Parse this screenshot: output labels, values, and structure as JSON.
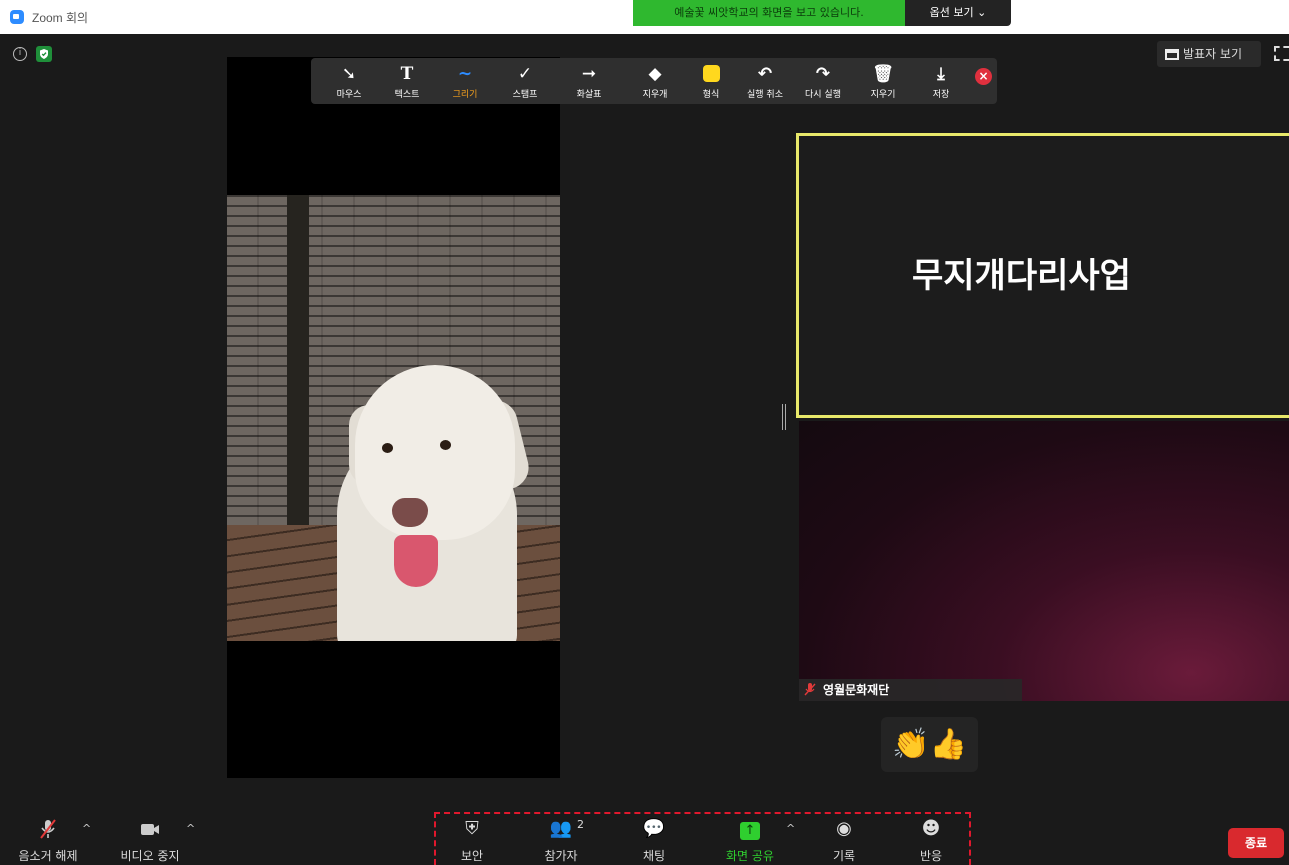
{
  "window": {
    "title": "Zoom 회의"
  },
  "share_banner": {
    "text": "예술꽃 씨앗학교의 화면을 보고 있습니다.",
    "options_label": "옵션 보기 ⌄"
  },
  "topbar": {
    "speaker_view_label": "발표자 보기"
  },
  "annotation_toolbar": {
    "tools": [
      {
        "id": "mouse",
        "icon": "arrow-cursor-icon",
        "label": "마우스"
      },
      {
        "id": "text",
        "icon": "text-t-icon",
        "label": "텍스트"
      },
      {
        "id": "draw",
        "icon": "squiggle-line-icon",
        "label": "그리기",
        "active": true
      },
      {
        "id": "stamp",
        "icon": "checkmark-icon",
        "label": "스탬프"
      },
      {
        "id": "arrow",
        "icon": "right-arrow-icon",
        "label": "화살표"
      },
      {
        "id": "eraser",
        "icon": "eraser-icon",
        "label": "지우개"
      },
      {
        "id": "format",
        "icon": "color-swatch-icon",
        "label": "형식",
        "color": "#ffd81e"
      },
      {
        "id": "undo",
        "icon": "undo-icon",
        "label": "실행 취소"
      },
      {
        "id": "redo",
        "icon": "redo-icon",
        "label": "다시 실행"
      },
      {
        "id": "clear",
        "icon": "trash-icon",
        "label": "지우기"
      },
      {
        "id": "save",
        "icon": "save-download-icon",
        "label": "저장"
      }
    ]
  },
  "participants": {
    "active_speaker_name": "무지개다리사업",
    "video_tile_name": "영월문화재단"
  },
  "reactions": {
    "emojis": "👏👍"
  },
  "bottom_toolbar": {
    "mute_label": "음소거 해제",
    "video_label": "비디오 중지",
    "security_label": "보안",
    "participants_label": "참가자",
    "participants_count": "2",
    "chat_label": "채팅",
    "share_label": "화면 공유",
    "record_label": "기록",
    "reactions_label": "반응",
    "end_label": "종료"
  },
  "colors": {
    "share_green": "#2fb82f",
    "end_red": "#d9292e",
    "speaker_border": "#e8e86a",
    "accent_orange": "#f7a11d"
  }
}
